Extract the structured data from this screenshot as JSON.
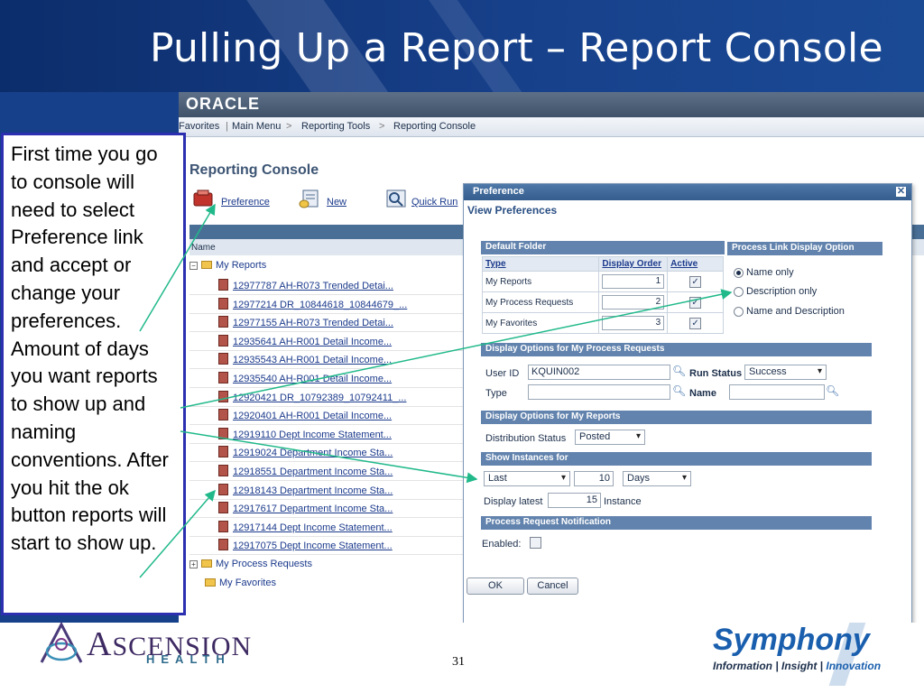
{
  "slide": {
    "title": "Pulling Up a Report – Report Console",
    "page_number": "31"
  },
  "app": {
    "brand": "ORACLE",
    "breadcrumb": [
      "Favorites",
      "Main Menu",
      "Reporting Tools",
      "Reporting Console"
    ],
    "separator": ">",
    "console_title": "Reporting Console",
    "toolbar": [
      {
        "label": "Preference",
        "icon": "preference-icon"
      },
      {
        "label": "New",
        "icon": "new-report-icon"
      },
      {
        "label": "Quick Run",
        "icon": "quick-run-icon"
      }
    ],
    "tree": {
      "name_header": "Name",
      "my_reports": "My Reports",
      "reports": [
        "12977787 AH-R073 Trended Detai...",
        "12977214 DR_10844618_10844679_...",
        "12977155 AH-R073 Trended Detai...",
        "12935641 AH-R001 Detail Income...",
        "12935543 AH-R001 Detail Income...",
        "12935540 AH-R001 Detail Income...",
        "12920421 DR_10792389_10792411_...",
        "12920401 AH-R001 Detail Income...",
        "12919110 Dept Income Statement...",
        "12919024 Department Income Sta...",
        "12918551 Department Income Sta...",
        "12918143 Department Income Sta...",
        "12917617 Department Income Sta...",
        "12917144 Dept Income Statement...",
        "12917075 Dept Income Statement..."
      ],
      "my_process_requests": "My Process Requests",
      "my_favorites": "My Favorites"
    }
  },
  "dialog": {
    "title": "Preference",
    "close": "✕",
    "subtitle": "View Preferences",
    "default_folder": {
      "header": "Default Folder",
      "columns": [
        "Type",
        "Display Order",
        "Active"
      ],
      "rows": [
        {
          "type": "My Reports",
          "order": "1",
          "active": true
        },
        {
          "type": "My Process Requests",
          "order": "2",
          "active": true
        },
        {
          "type": "My Favorites",
          "order": "3",
          "active": true
        }
      ]
    },
    "process_link": {
      "header": "Process Link Display Option",
      "options": [
        "Name only",
        "Description only",
        "Name and Description"
      ],
      "selected": "Name only"
    },
    "process_requests": {
      "header": "Display Options for My Process Requests",
      "user_id_label": "User ID",
      "user_id": "KQUIN002",
      "run_status_label": "Run Status",
      "run_status": "Success",
      "type_label": "Type",
      "type": "",
      "name_label": "Name",
      "name": ""
    },
    "my_reports": {
      "header": "Display Options for My Reports",
      "distribution_status_label": "Distribution Status",
      "distribution_status": "Posted"
    },
    "show_instances": {
      "header": "Show Instances for",
      "period": "Last",
      "count": "10",
      "unit": "Days",
      "display_latest_label": "Display latest",
      "display_latest": "15",
      "instance_label": "Instance"
    },
    "notification": {
      "header": "Process Request Notification",
      "enabled_label": "Enabled:",
      "enabled": false
    },
    "buttons": {
      "ok": "OK",
      "cancel": "Cancel"
    }
  },
  "annotation": {
    "text": "First time you go to console will need to select Preference link and accept or change your preferences. Amount of days you want reports to show up and naming conventions. After you hit the ok button reports will start to show up."
  },
  "footer": {
    "ascension": "SCENSION",
    "ascension_initial": "A",
    "health": "HEALTH",
    "symphony": "Symphony",
    "tagline_a": "Information | Insight | ",
    "tagline_b": "Innovation"
  },
  "colors": {
    "header_blue": "#17408a",
    "annotation_border": "#2b2fb0",
    "arrow_green": "#21b98a",
    "dialog_section": "#6283ad"
  }
}
